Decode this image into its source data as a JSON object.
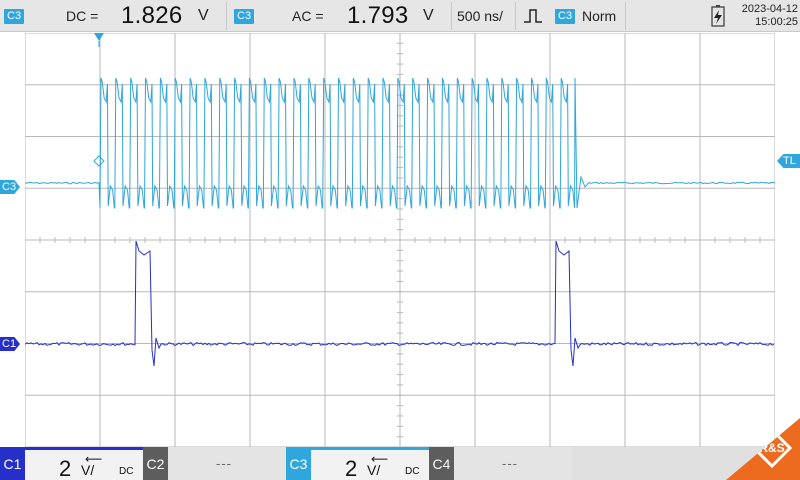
{
  "topbar": {
    "meas1": {
      "channel": "C3",
      "type": "DC =",
      "value": "1.826",
      "unit": "V"
    },
    "meas2": {
      "channel": "C3",
      "type": "AC =",
      "value": "1.793",
      "unit": "V"
    },
    "timebase": "500 ns/",
    "trigger": {
      "channel": "C3",
      "mode": "Norm"
    },
    "date": "2023-04-12",
    "time": "15:00:25"
  },
  "markers": {
    "c3": "C3",
    "c1": "C1",
    "trigger_level": "TL"
  },
  "bottombar": {
    "ch1": {
      "tag": "C1",
      "scale": "2",
      "unit": "V/",
      "coupling": "DC",
      "color": "#2630c8"
    },
    "ch2": {
      "tag": "C2",
      "value": "---"
    },
    "ch3": {
      "tag": "C3",
      "scale": "2",
      "unit": "V/",
      "coupling": "DC",
      "color": "#2fa6dc"
    },
    "ch4": {
      "tag": "C4",
      "value": "---"
    }
  },
  "logo_text": "R&S",
  "colors": {
    "c3": "#2fa6dc",
    "c1": "#2630c8",
    "grid": "#b8b8b8"
  },
  "grid": {
    "h_divs": 10,
    "v_divs": 8
  },
  "chart_data": {
    "type": "line",
    "series": [
      {
        "name": "C3",
        "pulses": 32
      },
      {
        "name": "C1",
        "pulses": 2
      }
    ]
  }
}
